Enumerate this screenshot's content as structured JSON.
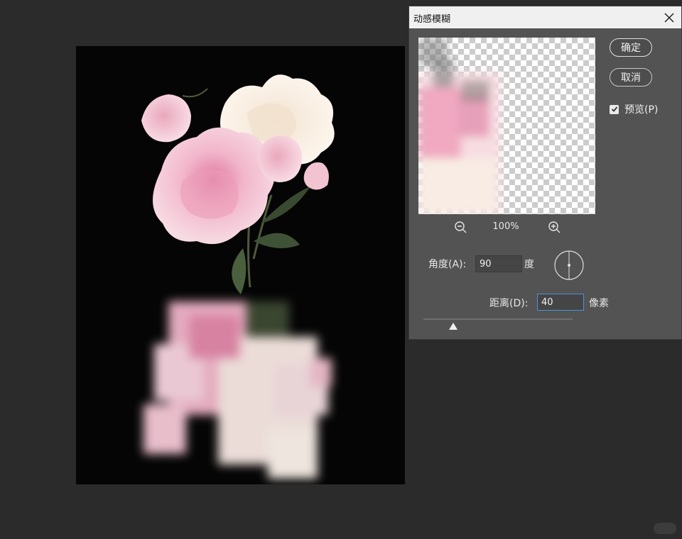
{
  "dialog": {
    "title": "动感模糊",
    "ok_label": "确定",
    "cancel_label": "取消",
    "preview_label": "预览(P)",
    "preview_checked": true,
    "zoom_level": "100%",
    "angle_label": "角度(A):",
    "angle_value": "90",
    "angle_unit": "度",
    "distance_label": "距离(D):",
    "distance_value": "40",
    "distance_unit": "像素",
    "distance_slider_fraction": 0.2
  },
  "icons": {
    "close": "close-icon",
    "zoom_out": "zoom-out-icon",
    "zoom_in": "zoom-in-icon",
    "checkbox": "checkmark-icon",
    "slider": "slider-thumb-triangle"
  },
  "colors": {
    "workspace": "#2b2b2b",
    "dialog_bg": "#535353",
    "titlebar": "#f0f0f0",
    "canvas_bg": "#050505",
    "focus_border": "#4a90e2"
  },
  "watermark": ""
}
